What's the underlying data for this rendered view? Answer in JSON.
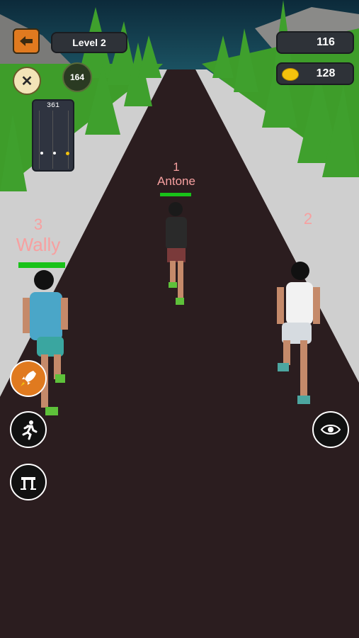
{
  "hud": {
    "level_label": "Level 2",
    "score": "116",
    "coins": "128",
    "distance": "164",
    "minimap_value": "361"
  },
  "runners": [
    {
      "rank": "1",
      "name": "Antone"
    },
    {
      "rank": "2",
      "name": ""
    },
    {
      "rank": "3",
      "name": "Wally"
    }
  ],
  "colors": {
    "road": "#2b1d1f",
    "grass": "#3e9d2a",
    "sidewalk": "#c9c9c9",
    "accent_orange": "#e07a1f",
    "health_green": "#19c219"
  }
}
